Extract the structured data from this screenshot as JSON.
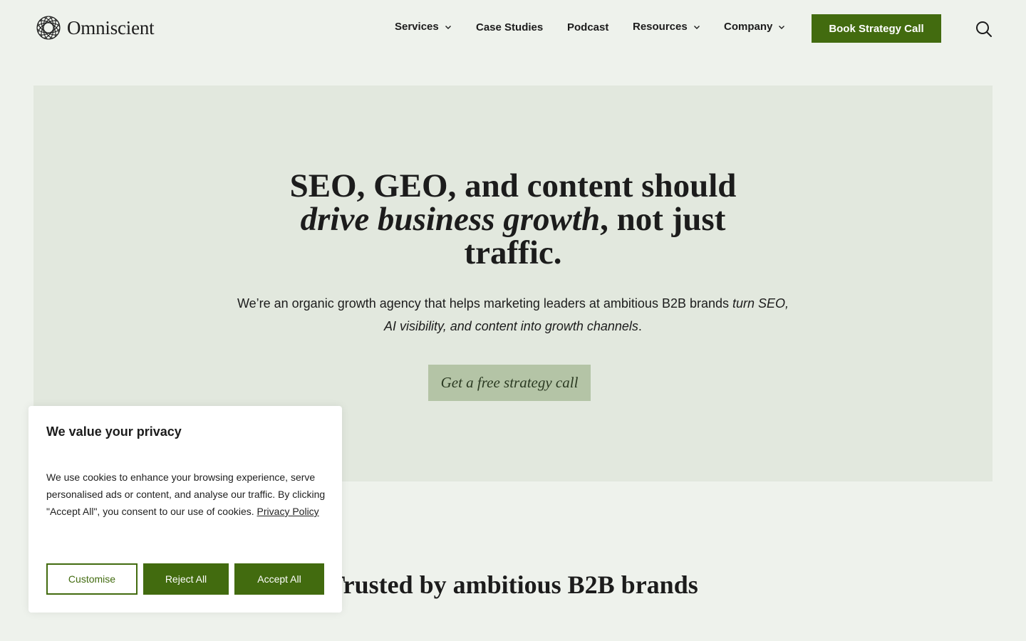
{
  "header": {
    "logo_text": "Omniscient",
    "nav": [
      {
        "label": "Services",
        "has_dropdown": true
      },
      {
        "label": "Case Studies",
        "has_dropdown": false
      },
      {
        "label": "Podcast",
        "has_dropdown": false
      },
      {
        "label": "Resources",
        "has_dropdown": true
      },
      {
        "label": "Company",
        "has_dropdown": true
      }
    ],
    "cta_label": "Book Strategy Call",
    "search_icon": "search-icon"
  },
  "hero": {
    "title_line1": "SEO, GEO, and content should",
    "title_italic": "drive business growth",
    "title_rest": ", not just",
    "title_line3": "traffic.",
    "subtitle_plain": "We’re an organic growth agency that helps marketing leaders at ambitious B2B brands ",
    "subtitle_italic": "turn SEO, AI visibility, and content into growth channels",
    "subtitle_end": ".",
    "cta_label": "Get a free strategy call"
  },
  "trusted_heading": "Trusted by ambitious B2B brands",
  "cookie": {
    "title": "We value your privacy",
    "body": "We use cookies to enhance your browsing experience, serve personalised ads or content, and analyse our traffic. By clicking \"Accept All\", you consent to our use of cookies. ",
    "policy_link": "Privacy Policy",
    "customise_label": "Customise",
    "reject_label": "Reject All",
    "accept_label": "Accept All"
  },
  "colors": {
    "page_bg": "#eef2ec",
    "hero_bg": "#e2e8de",
    "brand_green": "#426b0f",
    "hero_cta_bg": "#b4c4a6"
  }
}
